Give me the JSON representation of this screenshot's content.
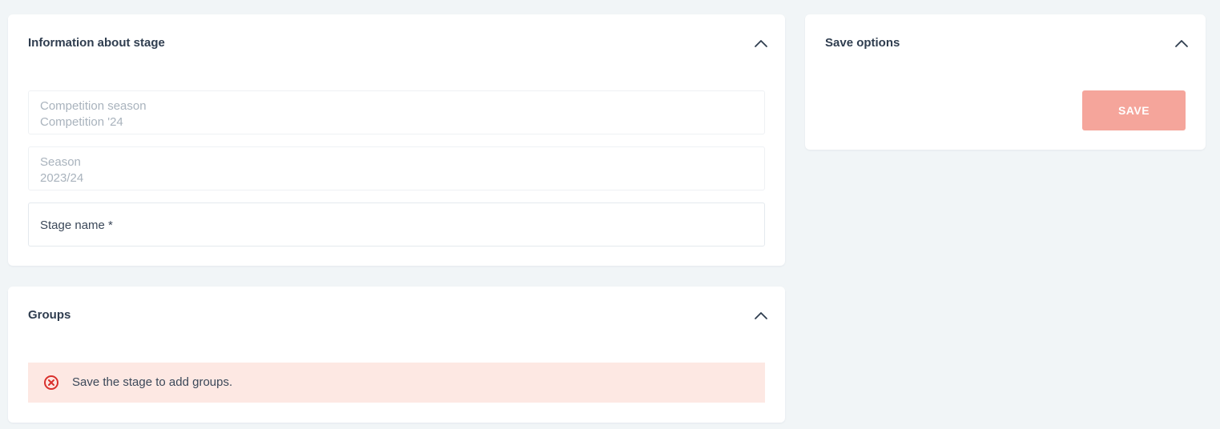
{
  "info_card": {
    "title": "Information about stage",
    "fields": [
      {
        "label": "Competition season",
        "value": "Competition '24"
      },
      {
        "label": "Season",
        "value": "2023/24"
      }
    ],
    "stage_name_placeholder": "Stage name *"
  },
  "groups_card": {
    "title": "Groups",
    "alert_text": "Save the stage to add groups."
  },
  "save_card": {
    "title": "Save options",
    "save_label": "SAVE"
  },
  "colors": {
    "background": "#f1f5f7",
    "card": "#ffffff",
    "save_button": "#f5a59b",
    "alert_background": "#fde8e3",
    "alert_icon": "#d9302c"
  },
  "icons": {
    "collapse": "chevron-up-icon",
    "alert": "error-circle-x-icon"
  }
}
